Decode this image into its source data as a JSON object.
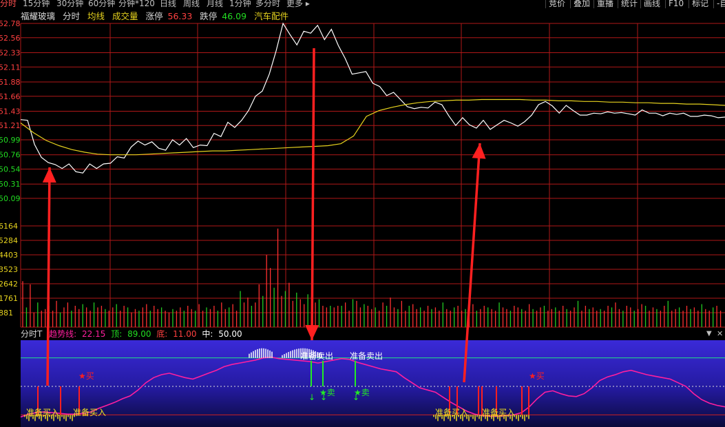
{
  "toolbar": {
    "tabs": [
      "分时",
      "15分钟",
      "30分钟",
      "60分钟",
      "分钟*120",
      "日线",
      "周线",
      "月线",
      "1分钟",
      "多分时",
      "更多 ▸"
    ],
    "active_tab": "分时",
    "right_buttons": [
      "竞价",
      "叠加",
      "重播",
      "统计",
      "画线",
      "F10",
      "标记",
      "-自"
    ]
  },
  "info": {
    "stock_name": "福耀玻璃",
    "mode": "分时",
    "avg_line_label": "均线",
    "volume_label": "成交量",
    "limit_up_label": "涨停",
    "limit_up_value": "56.33",
    "limit_down_label": "跌停",
    "limit_down_value": "46.09",
    "sector": "汽车配件"
  },
  "price_axis": {
    "labels": [
      "52.78",
      "52.56",
      "52.33",
      "52.11",
      "51.88",
      "51.66",
      "51.43",
      "51.21",
      "50.99",
      "50.76",
      "50.54",
      "50.31",
      "50.09"
    ],
    "min": 50.09,
    "max": 52.78
  },
  "volume_axis": {
    "labels": [
      "6164",
      "5284",
      "4403",
      "3523",
      "2642",
      "1761",
      "881"
    ],
    "max": 6164
  },
  "indicator": {
    "title": "分时T",
    "trend_label": "趋势线:",
    "trend_value": "22.15",
    "top_label": "顶:",
    "top_value": "89.00",
    "bottom_label": "底:",
    "bottom_value": "11.00",
    "mid_label": "中:",
    "mid_value": "50.00",
    "collapse_icon": "▼",
    "close_icon": "✕"
  },
  "signals": {
    "buy_ready": "准备买入",
    "sell_ready": "准备卖出",
    "buy_star": "★买",
    "sell_star": "★卖",
    "star_buy_label": "买",
    "star_sell_label": "卖"
  },
  "colors": {
    "price_line": "#ffffff",
    "avg_line": "#e6d21e",
    "grid": "#b01818",
    "volume_up": "#ff3030",
    "volume_down": "#22cc22",
    "trend_line": "#ff1f9e",
    "buy_signal": "#ff1f1f",
    "sell_signal": "#22ee22",
    "indicator_bg_top": "#3a2ad8",
    "indicator_bg_bottom": "#0a0a3a"
  },
  "chart_data": {
    "type": "line",
    "series": [
      {
        "name": "分时",
        "values": [
          51.3,
          51.29,
          50.92,
          50.72,
          50.64,
          50.61,
          50.55,
          50.62,
          50.5,
          50.48,
          50.62,
          50.55,
          50.62,
          50.63,
          50.73,
          50.71,
          50.88,
          50.97,
          50.91,
          50.96,
          50.86,
          50.83,
          50.99,
          50.91,
          51.01,
          50.87,
          50.91,
          50.9,
          51.09,
          51.04,
          51.26,
          51.18,
          51.29,
          51.44,
          51.66,
          51.74,
          52.0,
          52.36,
          52.78,
          52.61,
          52.45,
          52.66,
          52.63,
          52.75,
          52.53,
          52.69,
          52.44,
          52.24,
          52.0,
          52.02,
          52.04,
          51.86,
          51.81,
          51.67,
          51.72,
          51.61,
          51.5,
          51.47,
          51.49,
          51.48,
          51.57,
          51.53,
          51.36,
          51.21,
          51.33,
          51.22,
          51.17,
          51.29,
          51.15,
          51.22,
          51.29,
          51.25,
          51.2,
          51.27,
          51.37,
          51.53,
          51.58,
          51.51,
          51.4,
          51.52,
          51.44,
          51.37,
          51.37,
          51.4,
          51.39,
          51.42,
          51.4,
          51.41,
          51.39,
          51.37,
          51.45,
          51.4,
          51.4,
          51.36,
          51.4,
          51.38,
          51.4,
          51.35,
          51.35,
          51.37,
          51.36,
          51.33,
          51.34
        ]
      },
      {
        "name": "均线",
        "values": [
          51.25,
          51.1,
          50.98,
          50.9,
          50.84,
          50.8,
          50.77,
          50.76,
          50.76,
          50.76,
          50.77,
          50.78,
          50.79,
          50.8,
          50.81,
          50.82,
          50.82,
          50.83,
          50.84,
          50.85,
          50.86,
          50.87,
          50.88,
          50.89,
          50.9,
          50.93,
          51.05,
          51.35,
          51.44,
          51.49,
          51.53,
          51.56,
          51.58,
          51.59,
          51.6,
          51.6,
          51.61,
          51.61,
          51.61,
          51.61,
          51.6,
          51.6,
          51.59,
          51.59,
          51.58,
          51.58,
          51.57,
          51.57,
          51.56,
          51.56,
          51.55,
          51.55,
          51.54,
          51.54,
          51.53,
          51.52
        ]
      }
    ],
    "volume": [
      2800,
      1200,
      2600,
      900,
      1500,
      1000,
      1100,
      1300,
      1000,
      1600,
      900,
      1200,
      1500,
      1000,
      1300,
      1100,
      1400,
      1200,
      1000,
      1500,
      1200,
      1300,
      1100,
      1000,
      1200,
      1400,
      1000,
      1300,
      1200,
      900,
      1100,
      1000,
      1200,
      1400,
      1000,
      1300,
      1100,
      1200,
      1000,
      900,
      1100,
      1000,
      1200,
      1000,
      1300,
      1100,
      1000,
      1400,
      1000,
      1200,
      1100,
      1300,
      1000,
      1500,
      1100,
      1200,
      1400,
      1000,
      2200,
      1500,
      1800,
      1300,
      1500,
      2600,
      1900,
      4400,
      3600,
      2400,
      6000,
      1900,
      2200,
      2700,
      1600,
      2100,
      1700,
      1400,
      2000,
      1900,
      1500,
      1700,
      1300,
      1200,
      1300,
      1200,
      1300,
      1300,
      1500,
      1000,
      1700,
      1600,
      1200,
      1400,
      1300,
      1100,
      1200,
      1000,
      1500,
      1300,
      1800,
      1200,
      1100,
      1600,
      1000,
      1300,
      1400,
      1100,
      1200,
      1000,
      1300,
      1100,
      1200,
      1000,
      1500,
      1100,
      1000,
      1200,
      1300,
      1000,
      1100,
      1200,
      1400,
      1000,
      1100,
      1300,
      1200,
      1100,
      1000,
      1500,
      1200,
      1100,
      1000,
      1300,
      1200,
      1100,
      1000,
      1400,
      1100,
      1000,
      1200,
      1300,
      1000,
      1100,
      1200,
      1000,
      1300,
      1100,
      1000,
      1200,
      1600,
      1000,
      1300,
      1100,
      1200,
      1000,
      1100,
      1000,
      1300,
      1200,
      1500,
      1100,
      1000,
      1300,
      1200,
      1000,
      1100,
      1400,
      1300,
      1000,
      1200,
      1100,
      1000,
      1300,
      1600,
      1000,
      1100,
      1200,
      1000,
      1300,
      1100,
      1200,
      1000,
      1400,
      1100,
      1000,
      1200,
      1300,
      1000
    ],
    "trend": [
      8,
      12,
      14,
      15,
      14,
      13,
      12,
      12,
      13,
      15,
      20,
      24,
      28,
      33,
      37,
      45,
      55,
      62,
      66,
      68,
      65,
      62,
      60,
      64,
      68,
      72,
      77,
      80,
      82,
      84,
      86,
      89,
      90,
      88,
      87,
      86,
      85,
      84,
      82,
      84,
      86,
      88,
      87,
      83,
      80,
      77,
      74,
      72,
      70,
      62,
      55,
      48,
      45,
      42,
      35,
      28,
      22,
      16,
      12,
      10,
      9,
      9,
      10,
      11,
      14,
      22,
      33,
      42,
      44,
      40,
      37,
      36,
      40,
      48,
      58,
      63,
      66,
      70,
      72,
      69,
      66,
      64,
      62,
      60,
      55,
      50,
      40,
      32,
      27,
      24,
      22
    ],
    "indicator_range": [
      0,
      100
    ],
    "xlabel": "",
    "ylabel": ""
  }
}
